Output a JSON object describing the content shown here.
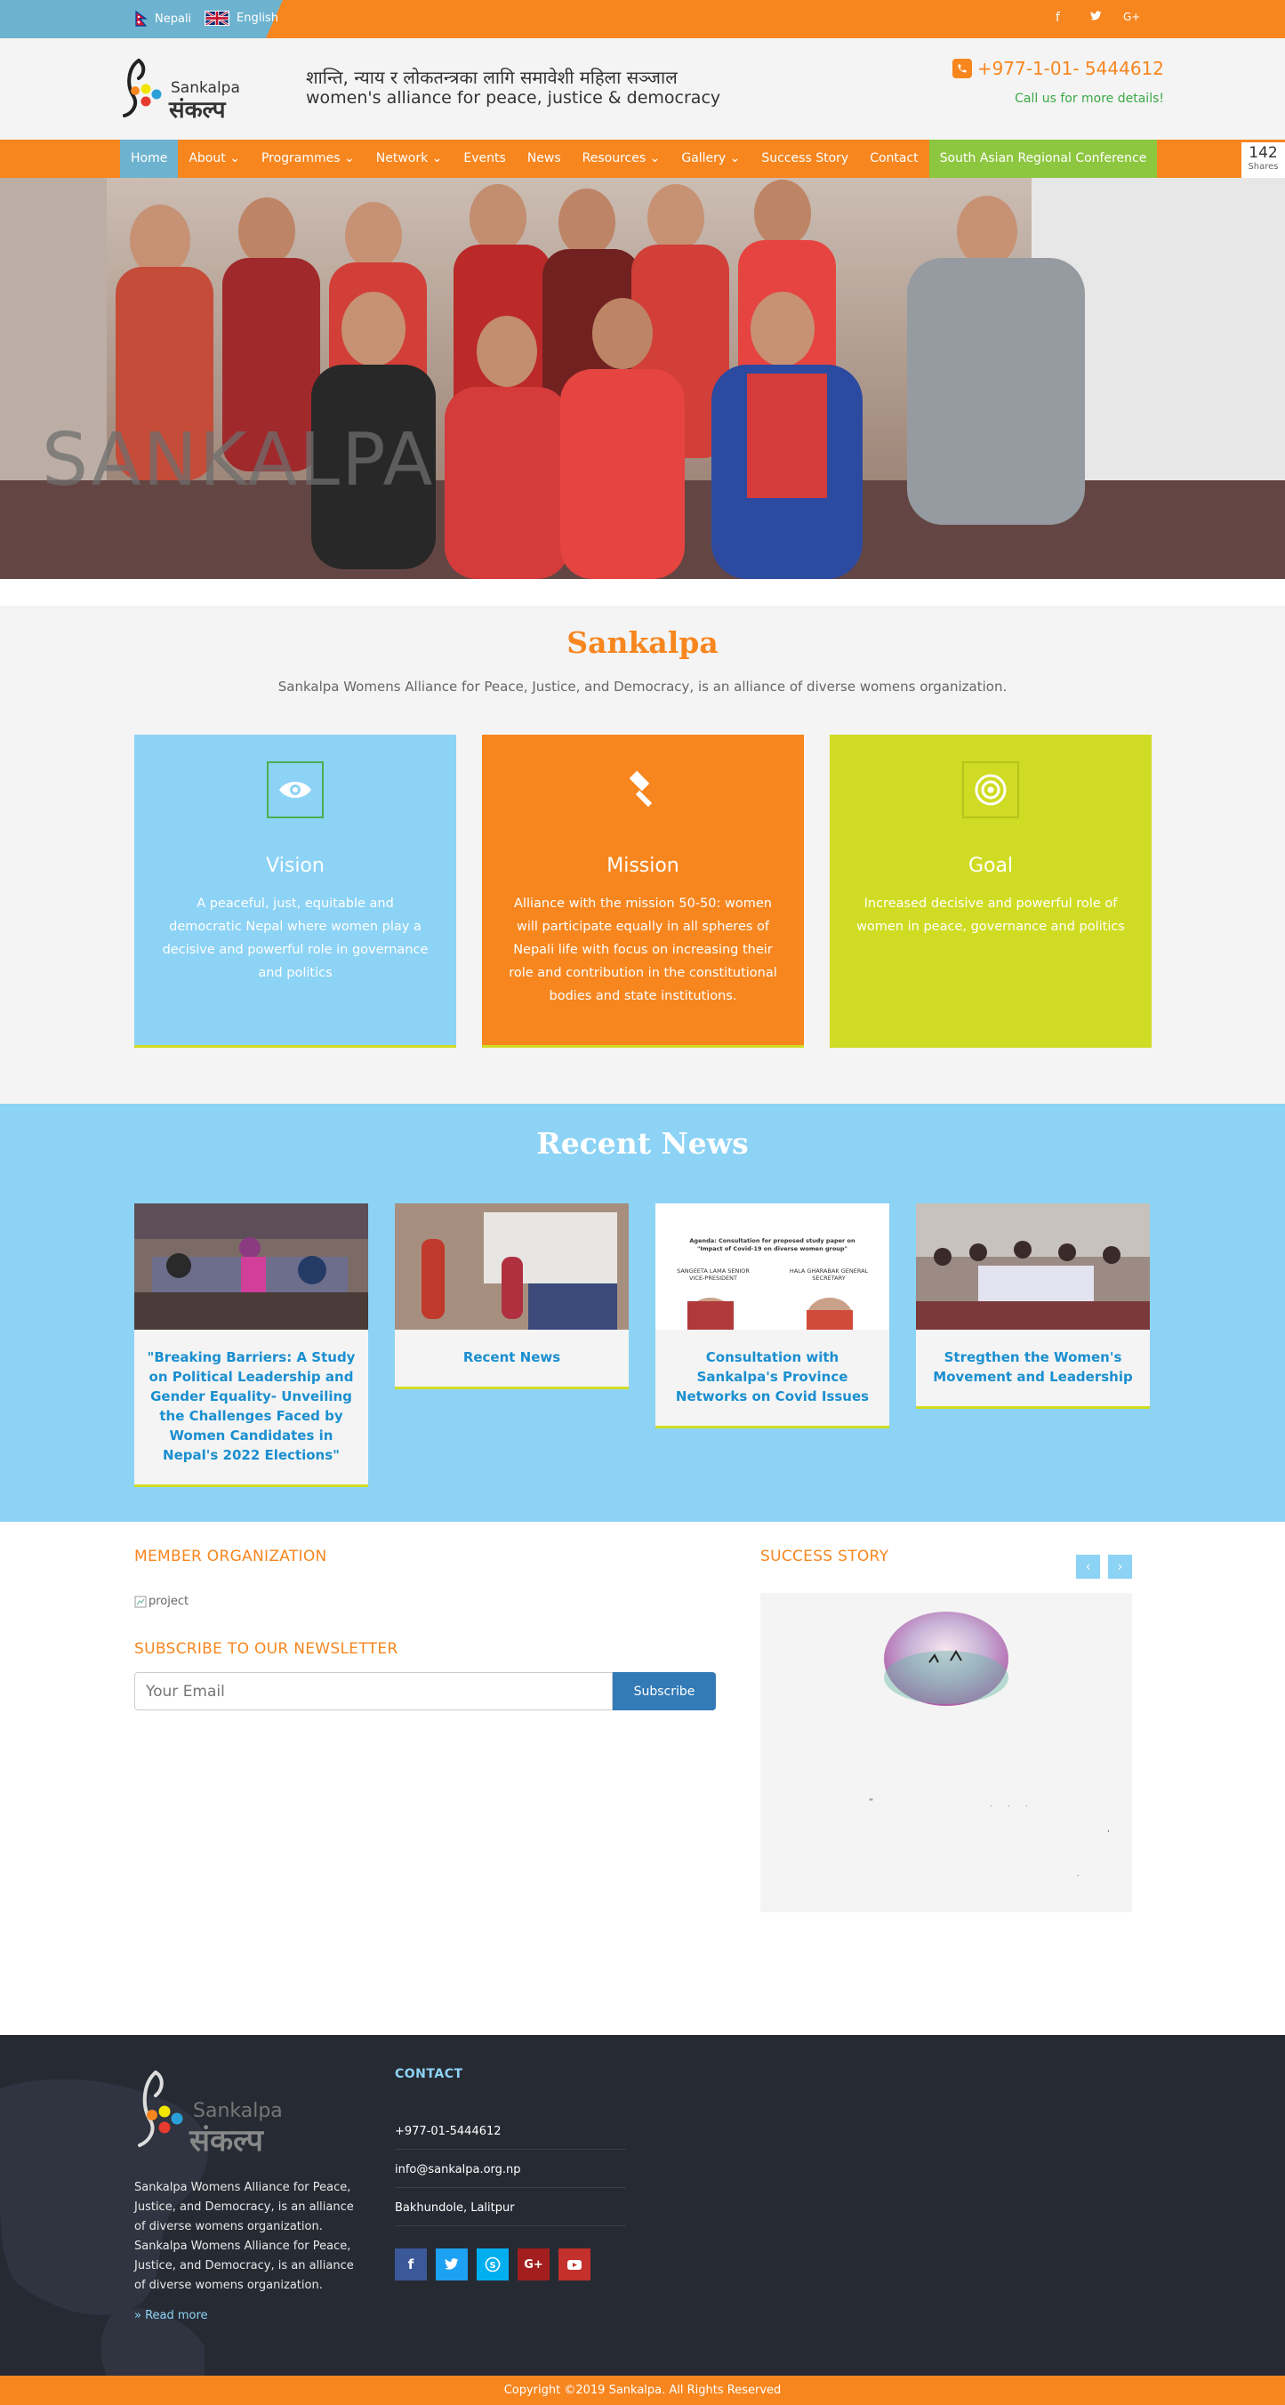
{
  "topbar": {
    "lang_nepali": "Nepali",
    "lang_english": "English",
    "social": [
      "f",
      "t",
      "G+"
    ]
  },
  "header": {
    "logo_text_en": "Sankalpa",
    "logo_text_np": "संकल्प",
    "tagline_np": "शान्ति, न्याय र लोकतन्त्रका लागि समावेशी महिला सञ्जाल",
    "tagline_en": "women's alliance for peace, justice & democracy",
    "phone": "+977-1-01- 5444612",
    "call_us": "Call us for more details!"
  },
  "nav": {
    "items": [
      {
        "label": "Home",
        "dropdown": false
      },
      {
        "label": "About",
        "dropdown": true
      },
      {
        "label": "Programmes",
        "dropdown": true
      },
      {
        "label": "Network",
        "dropdown": true
      },
      {
        "label": "Events",
        "dropdown": false
      },
      {
        "label": "News",
        "dropdown": false
      },
      {
        "label": "Resources",
        "dropdown": true
      },
      {
        "label": "Gallery",
        "dropdown": true
      },
      {
        "label": "Success Story",
        "dropdown": false
      },
      {
        "label": "Contact",
        "dropdown": false
      },
      {
        "label": "South Asian Regional Conference",
        "dropdown": false
      }
    ]
  },
  "share": {
    "count": "142",
    "label": "Shares"
  },
  "hero": {
    "title": "SANKALPA"
  },
  "about": {
    "title": "Sankalpa",
    "subtitle": "Sankalpa Womens Alliance for Peace, Justice, and Democracy, is an alliance of diverse womens organization.",
    "cards": [
      {
        "title": "Vision",
        "icon": "eye-icon",
        "text": "A peaceful, just, equitable and democratic Nepal where women play a decisive and powerful role in governance and politics"
      },
      {
        "title": "Mission",
        "icon": "gavel-icon",
        "text": "Alliance with the mission 50-50: women will participate equally in all spheres of Nepali life with focus on increasing their role and contribution in the constitutional bodies and state institutions."
      },
      {
        "title": "Goal",
        "icon": "target-icon",
        "text": "Increased decisive and powerful role of women in peace, governance and politics"
      }
    ]
  },
  "news": {
    "title": "Recent News",
    "items": [
      {
        "title": "\"Breaking Barriers: A Study on Political Leadership and Gender Equality- Unveiling the Challenges Faced by Women Candidates in Nepal's 2022 Elections\""
      },
      {
        "title": "Recent News"
      },
      {
        "title": "Consultation with Sankalpa's Province Networks on Covid Issues"
      },
      {
        "title": "Stregthen the Women's Movement and Leadership"
      }
    ],
    "poster_heading": "Agenda: Consultation for proposed study paper on \"Impact of Covid-19 on diverse women group\"",
    "poster_names": [
      "SANGEETA LAMA SENIOR VICE-PRESIDENT",
      "HALA GHARABAK GENERAL SECRETARY"
    ]
  },
  "member": {
    "title": "MEMBER ORGANIZATION",
    "img_alt": "project"
  },
  "newsletter": {
    "title": "SUBSCRIBE TO OUR NEWSLETTER",
    "placeholder": "Your Email",
    "button": "Subscribe"
  },
  "success": {
    "title": "SUCCESS STORY",
    "prev": "‹",
    "next": "›"
  },
  "footer": {
    "about": "Sankalpa Womens Alliance for Peace, Justice, and Democracy, is an alliance of diverse womens organization. Sankalpa Womens Alliance for Peace, Justice, and Democracy, is an alliance of diverse womens organization.",
    "read_more": "» Read more",
    "contact_title": "CONTACT",
    "phone": "+977-01-5444612",
    "email": "info@sankalpa.org.np",
    "address": "Bakhundole, Lalitpur",
    "copyright": "Copyright ©2019 Sankalpa. All Rights Reserved"
  },
  "colors": {
    "orange": "#f7861f",
    "sky": "#8dd3f5",
    "lime": "#d0dc23",
    "green": "#8dc63f",
    "steel": "#6db3cf",
    "footer": "#262a33"
  }
}
